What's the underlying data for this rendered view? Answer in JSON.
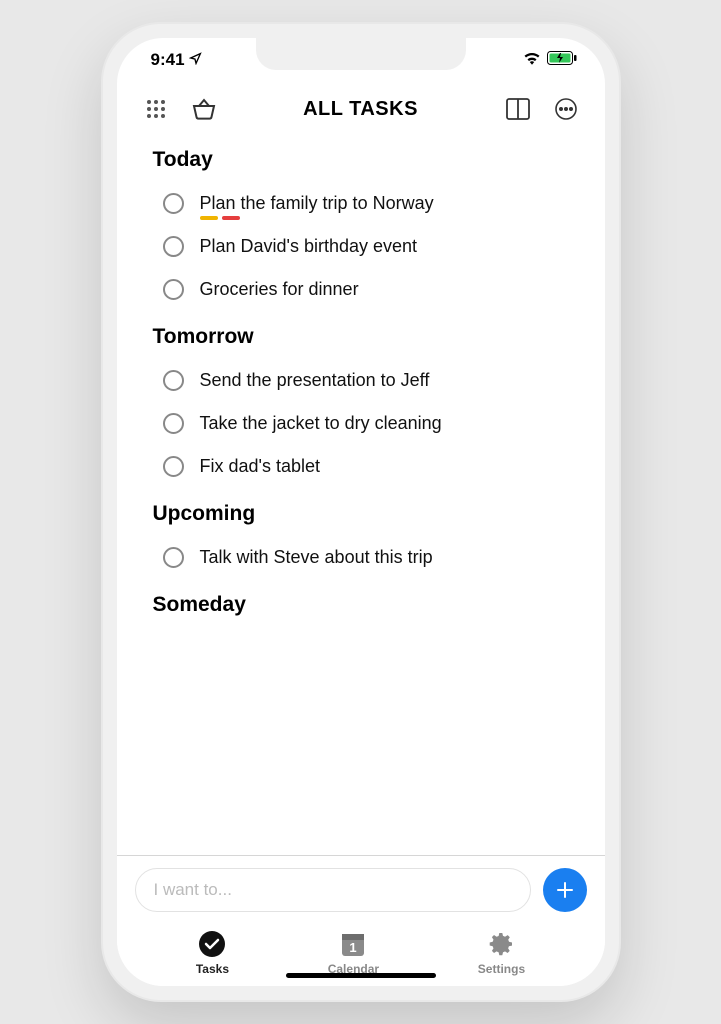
{
  "status": {
    "time": "9:41"
  },
  "header": {
    "title": "ALL TASKS"
  },
  "sections": [
    {
      "title": "Today",
      "tasks": [
        {
          "text": "Plan the family trip to Norway",
          "tags": [
            "#f0b400",
            "#e53e3e"
          ]
        },
        {
          "text": "Plan David's birthday event"
        },
        {
          "text": "Groceries for dinner"
        }
      ]
    },
    {
      "title": "Tomorrow",
      "tasks": [
        {
          "text": "Send the presentation to Jeff"
        },
        {
          "text": "Take the jacket to dry cleaning"
        },
        {
          "text": "Fix dad's tablet"
        }
      ]
    },
    {
      "title": "Upcoming",
      "tasks": [
        {
          "text": "Talk with Steve about this trip"
        }
      ]
    },
    {
      "title": "Someday",
      "tasks": []
    }
  ],
  "input": {
    "placeholder": "I want to..."
  },
  "tabs": {
    "tasks": "Tasks",
    "calendar": "Calendar",
    "calendar_day": "1",
    "settings": "Settings"
  },
  "colors": {
    "accent": "#1a7ff0"
  }
}
